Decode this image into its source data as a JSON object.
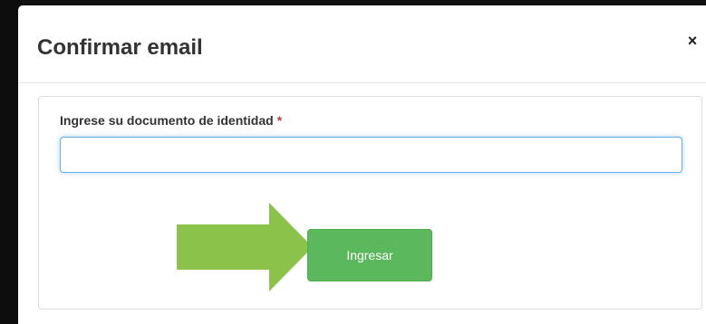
{
  "modal": {
    "title": "Confirmar email",
    "close_label": "×"
  },
  "form": {
    "field_label": "Ingrese su documento de identidad",
    "required_marker": "*",
    "input_value": "",
    "input_placeholder": "",
    "submit_label": "Ingresar"
  },
  "colors": {
    "submit_button": "#5cb85c",
    "arrow": "#8bc34a",
    "required_marker": "#a94442",
    "input_focus_border": "#66afe9"
  },
  "icons": {
    "close": "close-icon",
    "arrow": "arrow-right-icon"
  }
}
